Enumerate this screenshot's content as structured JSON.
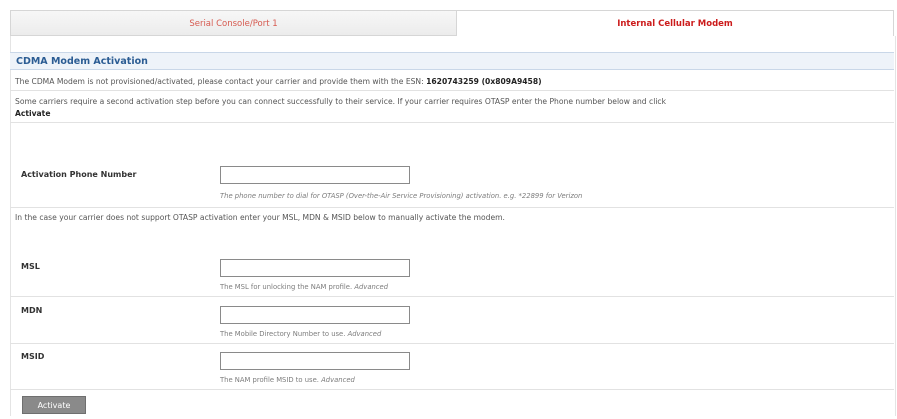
{
  "tabs": [
    {
      "label": "Serial Console/Port 1"
    },
    {
      "label": "Internal Cellular Modem"
    }
  ],
  "section_title": "CDMA Modem Activation",
  "intro": {
    "text": "The CDMA Modem is not provisioned/activated, please contact your carrier and provide them with the ESN:",
    "esn": "1620743259 (0x809A9458)"
  },
  "second_step": {
    "text": "Some carriers require a second activation step before you can connect successfully to their service. If your carrier requires OTASP enter the Phone number below and click",
    "action": "Activate"
  },
  "activation_phone": {
    "label": "Activation Phone Number",
    "value": "",
    "help": "The phone number to dial for OTASP (Over-the-Air Service Provisioning) activation. e.g. *22899 for Verizon"
  },
  "manual_note": "In the case your carrier does not support OTASP activation enter your MSL, MDN & MSID below to manually activate the modem.",
  "msl": {
    "label": "MSL",
    "value": "",
    "help": "The MSL for unlocking the NAM profile.",
    "advanced": "Advanced"
  },
  "mdn": {
    "label": "MDN",
    "value": "",
    "help": "The Mobile Directory Number to use.",
    "advanced": "Advanced"
  },
  "msid": {
    "label": "MSID",
    "value": "",
    "help": "The NAM profile MSID to use.",
    "advanced": "Advanced"
  },
  "activate_button": "Activate"
}
